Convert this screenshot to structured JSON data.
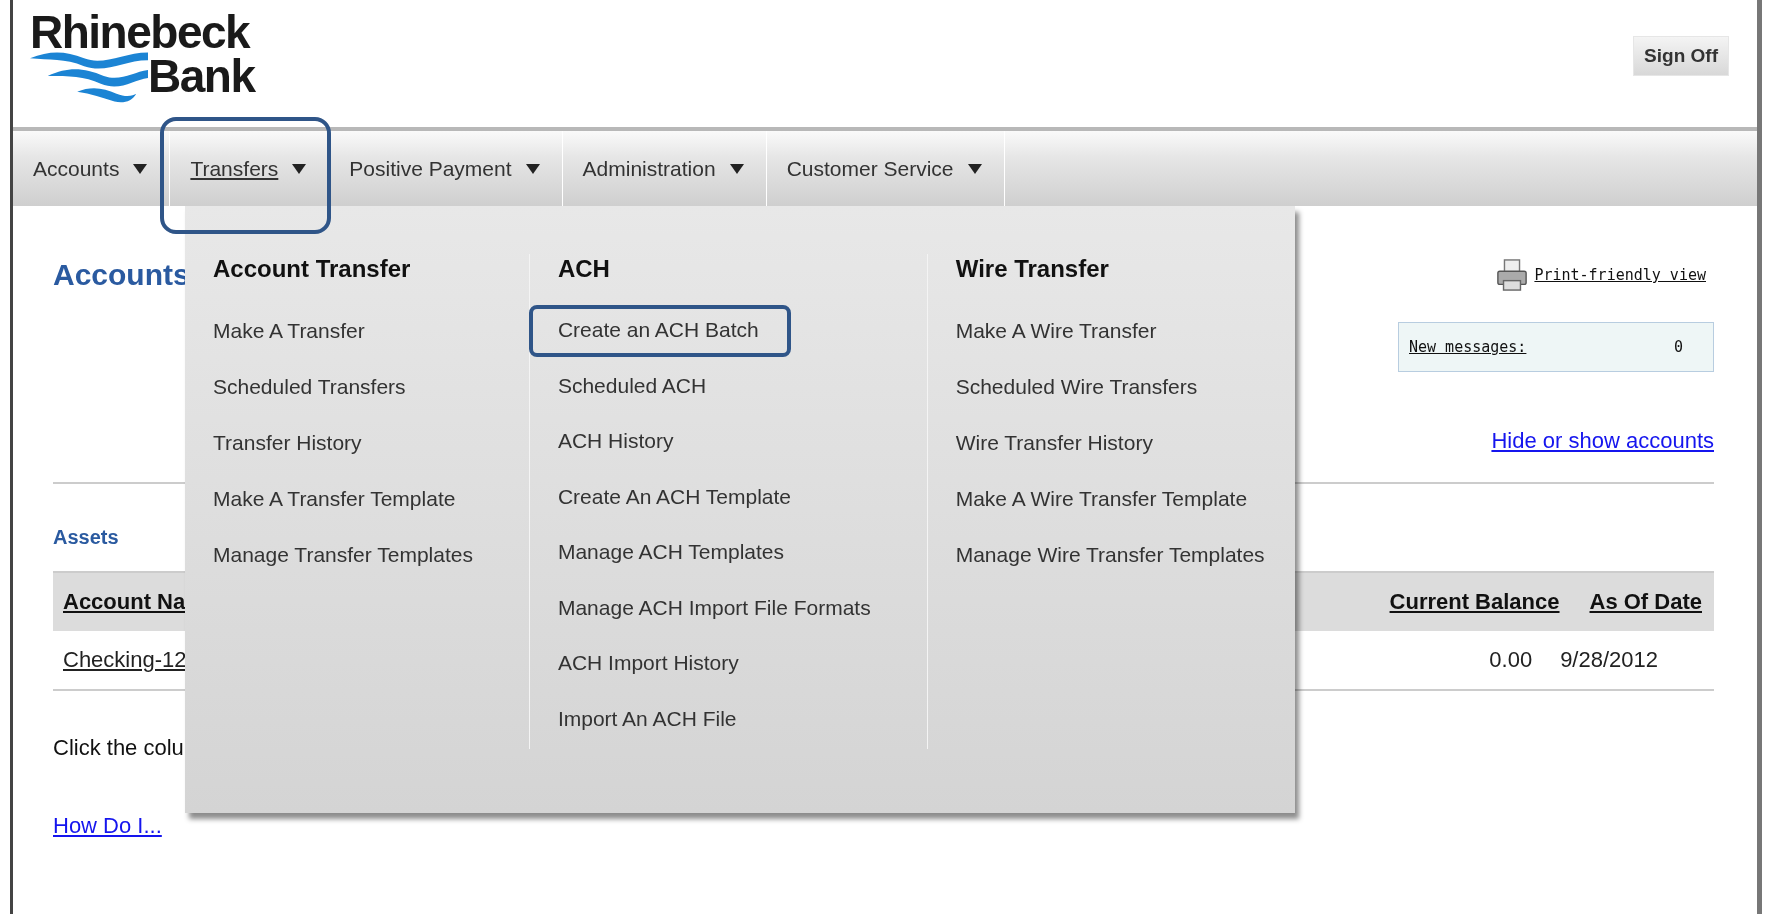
{
  "logo": {
    "line_1": "Rhinebeck",
    "line_2": "Bank"
  },
  "sign_off_button": "Sign Off",
  "nav": [
    {
      "label": "Accounts",
      "selected": false,
      "annotated": false
    },
    {
      "label": "Transfers",
      "selected": true,
      "annotated": true
    },
    {
      "label": "Positive Payment",
      "selected": false,
      "annotated": false
    },
    {
      "label": "Administration",
      "selected": false,
      "annotated": false
    },
    {
      "label": "Customer Service",
      "selected": false,
      "annotated": false
    }
  ],
  "dropdown": {
    "columns": [
      {
        "heading": "Account Transfer",
        "items": [
          {
            "label": "Make A Transfer",
            "annotated": false
          },
          {
            "label": "Scheduled Transfers",
            "annotated": false
          },
          {
            "label": "Transfer History",
            "annotated": false
          },
          {
            "label": "Make A Transfer Template",
            "annotated": false
          },
          {
            "label": "Manage Transfer Templates",
            "annotated": false
          }
        ]
      },
      {
        "heading": "ACH",
        "items": [
          {
            "label": "Create an ACH Batch",
            "annotated": true
          },
          {
            "label": "Scheduled ACH",
            "annotated": false
          },
          {
            "label": "ACH History",
            "annotated": false
          },
          {
            "label": "Create An ACH Template",
            "annotated": false
          },
          {
            "label": "Manage ACH Templates",
            "annotated": false
          },
          {
            "label": "Manage ACH Import File Formats",
            "annotated": false
          },
          {
            "label": "ACH Import History",
            "annotated": false
          },
          {
            "label": "Import An ACH File",
            "annotated": false
          }
        ]
      },
      {
        "heading": "Wire Transfer",
        "items": [
          {
            "label": "Make A Wire Transfer",
            "annotated": false
          },
          {
            "label": "Scheduled Wire Transfers",
            "annotated": false
          },
          {
            "label": "Wire Transfer History",
            "annotated": false
          },
          {
            "label": "Make A Wire Transfer Template",
            "annotated": false
          },
          {
            "label": "Manage Wire Transfer Templates",
            "annotated": false
          }
        ]
      }
    ]
  },
  "page": {
    "title": "Accounts",
    "print_link": "Print-friendly view",
    "messages": {
      "label": "New messages:",
      "count": "0"
    },
    "hide_show_link": "Hide or show accounts",
    "section": "Assets",
    "table": {
      "columns": [
        "Account Na",
        "Current Balance",
        "As Of Date"
      ],
      "rows": [
        [
          "Checking-12",
          "0.00",
          "9/28/2012"
        ]
      ]
    },
    "hint": "Click the colu",
    "help_link": "How Do I..."
  }
}
